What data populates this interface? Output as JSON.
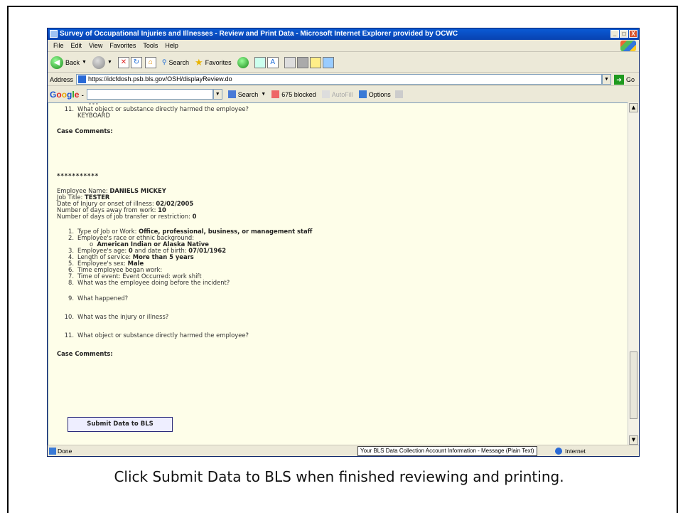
{
  "window": {
    "title": "Survey of Occupational Injuries and Illnesses - Review and Print Data - Microsoft Internet Explorer provided by OCWC",
    "controls": [
      "_",
      "□",
      "X"
    ]
  },
  "menu": [
    "File",
    "Edit",
    "View",
    "Favorites",
    "Tools",
    "Help"
  ],
  "toolbar": {
    "back": "Back",
    "search": "Search",
    "favorites": "Favorites"
  },
  "address": {
    "label": "Address",
    "url": "https://idcfdosh.psb.bls.gov/OSH/displayReview.do",
    "go": "Go"
  },
  "googlebar": {
    "search": "Search",
    "blocked": "675 blocked",
    "autofill": "AutoFill",
    "options": "Options"
  },
  "page": {
    "prev_q11": "11.",
    "prev_q11_text": "What object or substance directly harmed the employee?",
    "prev_q11_answer": "KEYBOARD",
    "case_comments_1": "Case Comments:",
    "separator": "***********",
    "employee_name_label": "Employee Name:",
    "employee_name": "DANIELS MICKEY",
    "job_title_label": "Job Title:",
    "job_title": "TESTER",
    "date_label": "Date of Injury or onset of illness:",
    "date": "02/02/2005",
    "days_away_label": "Number of days away from work:",
    "days_away": "10",
    "days_transfer_label": "Number of days of job transfer or restriction:",
    "days_transfer": "0",
    "q1_num": "1.",
    "q1_label": "Type of Job or Work:",
    "q1_value": "Office, professional, business, or management staff",
    "q2_num": "2.",
    "q2_label": "Employee's race or ethnic background:",
    "q2_bullet": "o",
    "q2_value": "American Indian or Alaska Native",
    "q3_num": "3.",
    "q3_label": "Employee's age:",
    "q3_age": "0",
    "q3_mid": "and date of birth:",
    "q3_dob": "07/01/1962",
    "q4_num": "4.",
    "q4_label": "Length of service:",
    "q4_value": "More than 5 years",
    "q5_num": "5.",
    "q5_label": "Employee's sex:",
    "q5_value": "Male",
    "q6_num": "6.",
    "q6_label": "Time employee began work:",
    "q7_num": "7.",
    "q7_label": "Time of event: Event Occurred: work shift",
    "q8_num": "8.",
    "q8_label": "What was the employee doing before the incident?",
    "q9_num": "9.",
    "q9_label": "What happened?",
    "q10_num": "10.",
    "q10_label": "What was the injury or illness?",
    "q11_num": "11.",
    "q11_label": "What object or substance directly harmed the employee?",
    "case_comments_2": "Case Comments:",
    "submit_label": "Submit Data to BLS"
  },
  "status": {
    "text": "Done",
    "tooltip": "Your BLS Data Collection Account Information - Message (Plain Text)",
    "zone": "Internet"
  },
  "caption": "Click Submit Data to BLS when finished reviewing and printing."
}
